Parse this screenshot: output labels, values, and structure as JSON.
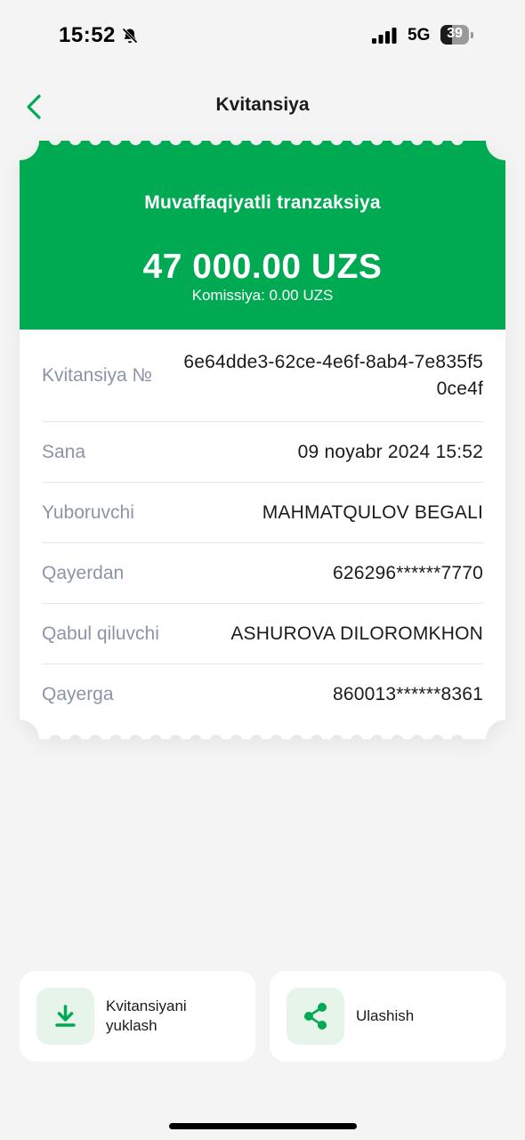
{
  "status_bar": {
    "time": "15:52",
    "network": "5G",
    "battery": "39",
    "icons": [
      "bell-slash-icon",
      "signal-icon",
      "battery-icon"
    ]
  },
  "nav": {
    "title": "Kvitansiya",
    "back_icon": "chevron-left-icon"
  },
  "receipt": {
    "status": "Muvaffaqiyatli tranzaksiya",
    "amount": "47 000.00 UZS",
    "commission": "Komissiya: 0.00 UZS",
    "rows": [
      {
        "label": "Kvitansiya №",
        "value": "6e64dde3-62ce-4e6f-8ab4-7e835f50ce4f"
      },
      {
        "label": "Sana",
        "value": "09 noyabr 2024 15:52"
      },
      {
        "label": "Yuboruvchi",
        "value": "MAHMATQULOV BEGALI"
      },
      {
        "label": "Qayerdan",
        "value": "626296******7770"
      },
      {
        "label": "Qabul qiluvchi",
        "value": "ASHUROVA DILOROMKHON"
      },
      {
        "label": "Qayerga",
        "value": "860013******8361"
      }
    ]
  },
  "actions": {
    "download": {
      "label": "Kvitansiyani yuklash",
      "icon": "download-icon"
    },
    "share": {
      "label": "Ulashish",
      "icon": "share-icon"
    }
  },
  "colors": {
    "accent": "#00aa52",
    "accent_light": "#e6f4ea",
    "background": "#f4f4f4",
    "label_gray": "#8b95a5"
  }
}
